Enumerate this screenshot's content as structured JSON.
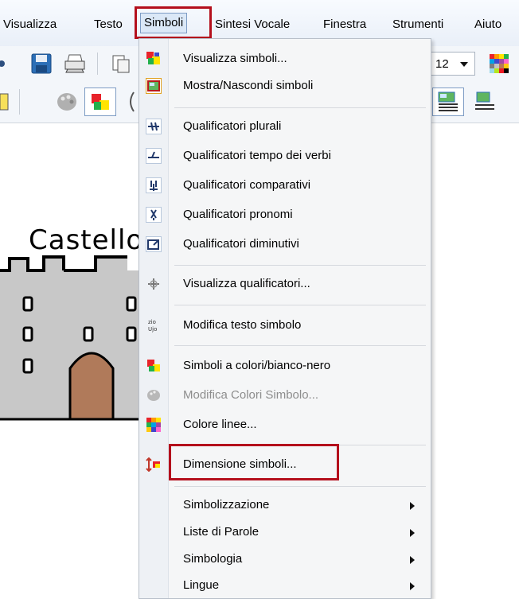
{
  "menubar": {
    "items": [
      "Visualizza",
      "Testo",
      "Simboli",
      "Sintesi Vocale",
      "Finestra",
      "Strumenti",
      "Aiuto"
    ],
    "active_index": 2
  },
  "toolbar": {
    "font_size": "12"
  },
  "document": {
    "title_text": "Castello"
  },
  "menu": {
    "items": [
      {
        "label": "Visualizza simboli...",
        "icon": "symbols-view-icon"
      },
      {
        "label": "Mostra/Nascondi simboli",
        "icon": "show-hide-symbols-icon"
      },
      {
        "label": "Qualificatori plurali",
        "icon": "plural-qualifier-icon"
      },
      {
        "label": "Qualificatori tempo dei verbi",
        "icon": "verb-tense-qualifier-icon"
      },
      {
        "label": "Qualificatori comparativi",
        "icon": "comparative-qualifier-icon"
      },
      {
        "label": "Qualificatori pronomi",
        "icon": "pronoun-qualifier-icon"
      },
      {
        "label": "Qualificatori diminutivi",
        "icon": "diminutive-qualifier-icon"
      },
      {
        "label": "Visualizza qualificatori...",
        "icon": "view-qualifiers-icon"
      },
      {
        "label": "Modifica testo simbolo",
        "icon": "edit-symbol-text-icon",
        "icon_text": "zio\nUjo"
      },
      {
        "label": "Simboli a colori/bianco-nero",
        "icon": "color-bw-symbols-icon"
      },
      {
        "label": "Modifica Colori Simbolo...",
        "icon": "palette-icon",
        "disabled": true
      },
      {
        "label": "Colore linee...",
        "icon": "line-color-icon"
      },
      {
        "label": "Dimensione simboli...",
        "icon": "symbol-size-icon"
      },
      {
        "label": "Simbolizzazione",
        "submenu": true
      },
      {
        "label": "Liste di Parole",
        "submenu": true
      },
      {
        "label": "Simbologia",
        "submenu": true
      },
      {
        "label": "Lingue",
        "submenu": true
      }
    ]
  },
  "highlight_color": "#b40f1c"
}
